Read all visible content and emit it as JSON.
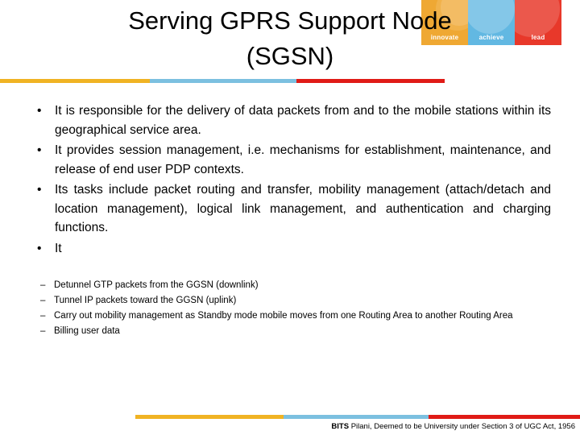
{
  "slide": {
    "title_lines": [
      "Serving GPRS Support Node",
      "(SGSN)"
    ],
    "bullets": [
      "It is responsible for the delivery of data packets from and to the mobile stations within its geographical service area.",
      "It provides session management, i.e. mechanisms for establishment, maintenance, and release of end user PDP contexts.",
      "Its tasks include packet routing and transfer, mobility management (attach/detach and location management), logical link management, and authentication and charging functions.",
      "It"
    ],
    "sub_bullets": [
      "Detunnel GTP packets from the GGSN (downlink)",
      "Tunnel IP packets toward the GGSN (uplink)",
      "Carry out mobility management as Standby mode mobile moves from one Routing Area to another Routing Area",
      "Billing user data"
    ],
    "bullet_marker": "•",
    "sub_bullet_marker": "–"
  },
  "logo": {
    "panels": [
      {
        "word": "innovate",
        "color": "#efa833"
      },
      {
        "word": "achieve",
        "color": "#62b8e2"
      },
      {
        "word": "lead",
        "color": "#e8382a"
      }
    ]
  },
  "header_bar": {
    "orange": "#f0b323",
    "blue": "#7cc0e0",
    "red": "#e01b16"
  },
  "footer": {
    "brand": "BITS",
    "text": " Pilani, Deemed to be University under Section 3 of UGC Act, 1956"
  }
}
